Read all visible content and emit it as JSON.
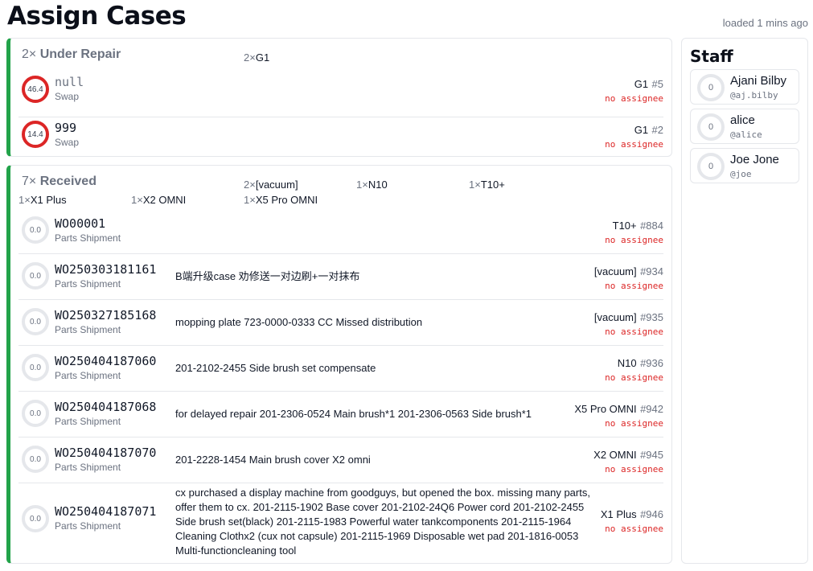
{
  "page": {
    "title": "Assign Cases",
    "loaded": "loaded 1 mins ago"
  },
  "groups": {
    "repair": {
      "count": "2×",
      "name": "Under Repair",
      "summary": [
        {
          "count": "2×",
          "model": "G1"
        }
      ],
      "rows": [
        {
          "score": "46.4",
          "title": "null",
          "subtitle": "Swap",
          "description": "",
          "model": "G1",
          "number": "#5",
          "assignee": "no assignee"
        },
        {
          "score": "14.4",
          "title": "999",
          "subtitle": "Swap",
          "description": "",
          "model": "G1",
          "number": "#2",
          "assignee": "no assignee"
        }
      ]
    },
    "received": {
      "count": "7×",
      "name": "Received",
      "summary": [
        {
          "count": "2×",
          "model": "[vacuum]"
        },
        {
          "count": "1×",
          "model": "N10"
        },
        {
          "count": "1×",
          "model": "T10+"
        },
        {
          "count": "1×",
          "model": "X1 Plus"
        },
        {
          "count": "1×",
          "model": "X2 OMNI"
        },
        {
          "count": "1×",
          "model": "X5 Pro OMNI"
        }
      ],
      "rows": [
        {
          "score": "0.0",
          "title": "WO00001",
          "subtitle": "Parts Shipment",
          "description": "",
          "model": "T10+",
          "number": "#884",
          "assignee": "no assignee"
        },
        {
          "score": "0.0",
          "title": "WO250303181161",
          "subtitle": "Parts Shipment",
          "description": "B端升级case 劝修送一对边刷+一对抹布",
          "model": "[vacuum]",
          "number": "#934",
          "assignee": "no assignee"
        },
        {
          "score": "0.0",
          "title": "WO250327185168",
          "subtitle": "Parts Shipment",
          "description": "mopping plate 723-0000-0333 CC Missed distribution",
          "model": "[vacuum]",
          "number": "#935",
          "assignee": "no assignee"
        },
        {
          "score": "0.0",
          "title": "WO250404187060",
          "subtitle": "Parts Shipment",
          "description": "201-2102-2455 Side brush set compensate",
          "model": "N10",
          "number": "#936",
          "assignee": "no assignee"
        },
        {
          "score": "0.0",
          "title": "WO250404187068",
          "subtitle": "Parts Shipment",
          "description": "for delayed repair 201-2306-0524 Main brush*1 201-2306-0563 Side brush*1",
          "model": "X5 Pro OMNI",
          "number": "#942",
          "assignee": "no assignee"
        },
        {
          "score": "0.0",
          "title": "WO250404187070",
          "subtitle": "Parts Shipment",
          "description": "201-2228-1454 Main brush cover X2 omni",
          "model": "X2 OMNI",
          "number": "#945",
          "assignee": "no assignee"
        },
        {
          "score": "0.0",
          "title": "WO250404187071",
          "subtitle": "Parts Shipment",
          "description": "cx purchased a display machine from goodguys, but opened the box. missing many parts, offer them to cx. 201-2115-1902 Base cover  201-2102-24Q6 Power cord  201-2102-2455 Side brush set(black)  201-2115-1983 Powerful water tankcomponents  201-2115-1964 Cleaning Clothx2 (cux not capsule)  201-2115-1969 Disposable wet pad  201-1816-0053 Multi-functioncleaning tool",
          "model": "X1 Plus",
          "number": "#946",
          "assignee": "no assignee"
        }
      ]
    }
  },
  "staff": {
    "title": "Staff",
    "members": [
      {
        "count": "0",
        "name": "Ajani Bilby",
        "handle": "@aj.bilby"
      },
      {
        "count": "0",
        "name": "alice",
        "handle": "@alice"
      },
      {
        "count": "0",
        "name": "Joe Jone",
        "handle": "@joe"
      }
    ]
  },
  "colors": {
    "accent_green": "#22a34a",
    "warning_red": "#dc2626",
    "muted_grey": "#6b7280"
  }
}
